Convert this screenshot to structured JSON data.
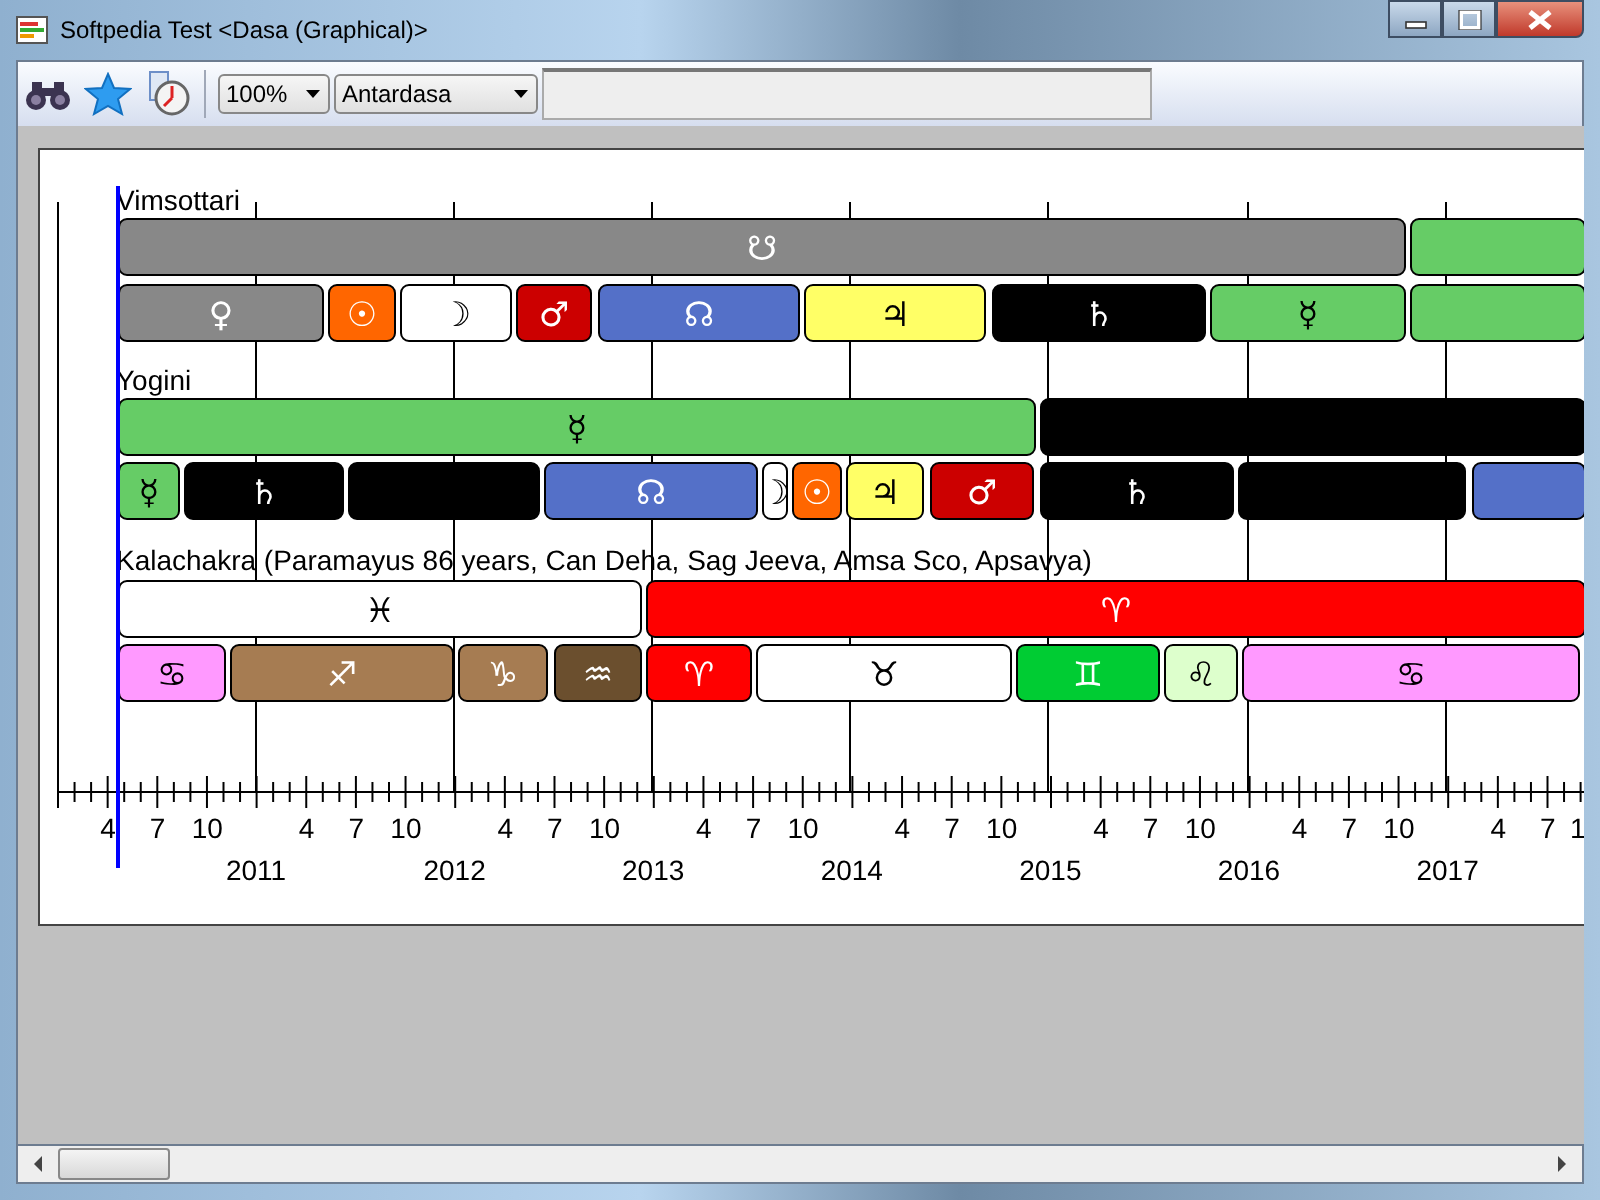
{
  "window": {
    "title": "Softpedia Test <Dasa (Graphical)>"
  },
  "toolbar": {
    "zoom": "100%",
    "dasa_level": "Antardasa"
  },
  "timeline": {
    "sections": [
      {
        "label": "Vimsottari",
        "rows": [
          [
            {
              "symbol": "☋",
              "color": "#888888"
            },
            {
              "color": "#66cc66"
            }
          ],
          [
            {
              "symbol": "♀",
              "color": "#888888"
            },
            {
              "symbol": "☉",
              "color": "#ff6600"
            },
            {
              "symbol": "☽",
              "color": "#ffffff"
            },
            {
              "symbol": "♂",
              "color": "#cc0000"
            },
            {
              "symbol": "☊",
              "color": "#5470c8"
            },
            {
              "symbol": "♃",
              "color": "#ffff66"
            },
            {
              "symbol": "♄",
              "color": "#000000"
            },
            {
              "symbol": "☿",
              "color": "#66cc66"
            },
            {
              "color": "#66cc66"
            }
          ]
        ]
      },
      {
        "label": "Yogini",
        "rows": [
          [
            {
              "symbol": "☿",
              "color": "#66cc66"
            },
            {
              "color": "#000000"
            }
          ],
          [
            {
              "symbol": "☿",
              "color": "#66cc66"
            },
            {
              "symbol": "♄",
              "color": "#000000"
            },
            {
              "color": "#000000"
            },
            {
              "symbol": "☊",
              "color": "#5470c8"
            },
            {
              "symbol": "☽",
              "color": "#ffffff"
            },
            {
              "symbol": "☉",
              "color": "#ff6600"
            },
            {
              "symbol": "♃",
              "color": "#ffff66"
            },
            {
              "symbol": "♂",
              "color": "#cc0000"
            },
            {
              "symbol": "♄",
              "color": "#000000"
            },
            {
              "color": "#000000"
            },
            {
              "color": "#5470c8"
            }
          ]
        ]
      },
      {
        "label": "Kalachakra (Paramayus 86 years, Can Deha, Sag Jeeva, Amsa Sco, Apsavya)",
        "rows": [
          [
            {
              "symbol": "♓",
              "color": "#ffffff"
            },
            {
              "symbol": "♈",
              "color": "#ff0000"
            }
          ],
          [
            {
              "symbol": "♋",
              "color": "#ff99ff"
            },
            {
              "symbol": "♐",
              "color": "#a67c52"
            },
            {
              "symbol": "♑",
              "color": "#a67c52"
            },
            {
              "symbol": "♒",
              "color": "#6b4f2e"
            },
            {
              "symbol": "♈",
              "color": "#ff0000"
            },
            {
              "symbol": "♉",
              "color": "#ffffff"
            },
            {
              "symbol": "♊",
              "color": "#00cc33"
            },
            {
              "symbol": "♌",
              "color": "#ddffcc"
            },
            {
              "symbol": "♋",
              "color": "#ff99ff"
            }
          ]
        ]
      }
    ],
    "axis": {
      "months": [
        "4",
        "7",
        "10",
        "4",
        "7",
        "10",
        "4",
        "7",
        "10",
        "4",
        "7",
        "10",
        "4",
        "7",
        "10",
        "4",
        "7",
        "10",
        "4",
        "7",
        "10",
        "4",
        "7",
        "1"
      ],
      "years": [
        "2011",
        "2012",
        "2013",
        "2014",
        "2015",
        "2016",
        "2017"
      ]
    }
  }
}
